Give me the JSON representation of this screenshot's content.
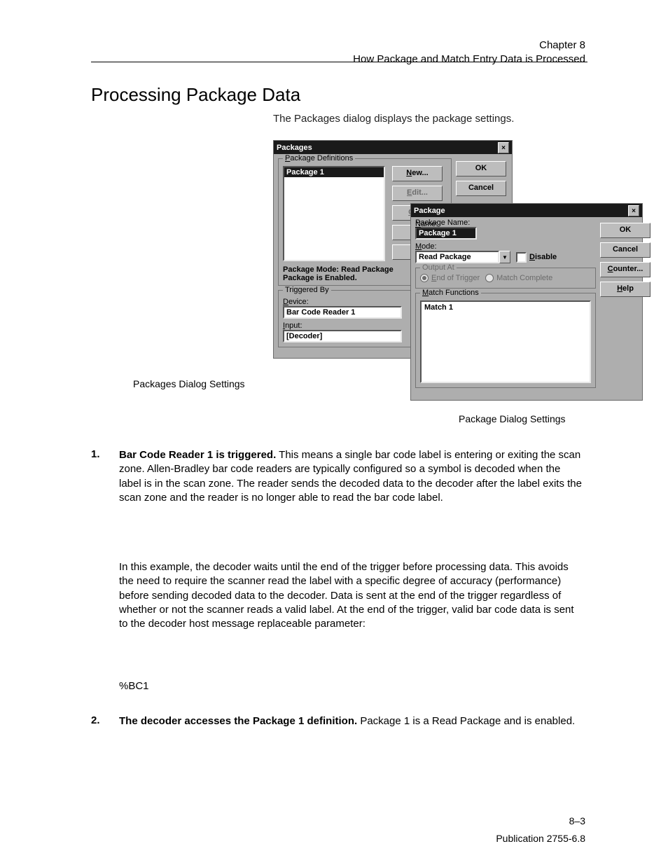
{
  "header": {
    "chapter": "Chapter 8",
    "subject": "How Package and Match Entry Data is Processed"
  },
  "section_title": "Processing Package Data",
  "intro_text": "The Packages dialog displays the package settings.",
  "packages_dialog": {
    "title": "Packages",
    "groups": {
      "definitions": {
        "legend": "Package Definitions",
        "list_selected": "Package 1",
        "buttons": {
          "new": "New...",
          "edit": "Edit...",
          "output": "Outp",
          "blank1": "",
          "blank2": ""
        },
        "mode_line": "Package Mode: Read Package",
        "enabled_line": "Package is Enabled."
      },
      "triggered_by": {
        "legend": "Triggered By",
        "device_label": "Device:",
        "device_value": "Bar Code Reader 1",
        "input_label": "Input:",
        "input_value": "[Decoder]"
      }
    },
    "side_buttons": {
      "ok": "OK",
      "cancel": "Cancel"
    }
  },
  "package_dialog": {
    "title": "Package",
    "name_label": "Package Name:",
    "name_value": "Package 1",
    "mode_label": "Mode:",
    "mode_value": "Read Package",
    "disable_label": "Disable",
    "output_at": {
      "legend": "Output At",
      "end_of_trigger": "End of Trigger",
      "match_complete": "Match Complete"
    },
    "match_functions": {
      "legend": "Match Functions",
      "item": "Match 1"
    },
    "side_buttons": {
      "ok": "OK",
      "cancel": "Cancel",
      "counter": "Counter...",
      "help": "Help"
    }
  },
  "captions": {
    "packages": "Packages Dialog Settings",
    "package": "Package Dialog Settings"
  },
  "step1": {
    "num": "1.",
    "bold": "Bar Code Reader 1 is triggered.",
    "body": "This means a single bar code label is entering or exiting the scan zone. Allen-Bradley bar code readers are typically configured so a symbol is decoded when the label is in the scan zone. The reader sends the decoded data to the decoder after the label exits the scan zone and the reader is no longer able to read the bar code label.",
    "cont": "In this example, the decoder waits until the end of the trigger before processing data. This avoids the need to require the scanner read the label with a specific degree of accuracy (performance) before sending decoded data to the decoder. Data is sent at the end of the trigger regardless of whether or not the scanner reads a valid label. At the end of the trigger, valid bar code data is sent to the decoder host message replaceable parameter:",
    "param": "%BC1"
  },
  "step2": {
    "num": "2.",
    "bold_prefix": "The decoder accesses the ",
    "bold_pkg": "Package 1",
    "bold_suffix": " definition.",
    "body": " Package 1 is a Read Package and is enabled."
  },
  "footer": {
    "pub": "Publication 2755-6.8",
    "page": "8–3"
  }
}
